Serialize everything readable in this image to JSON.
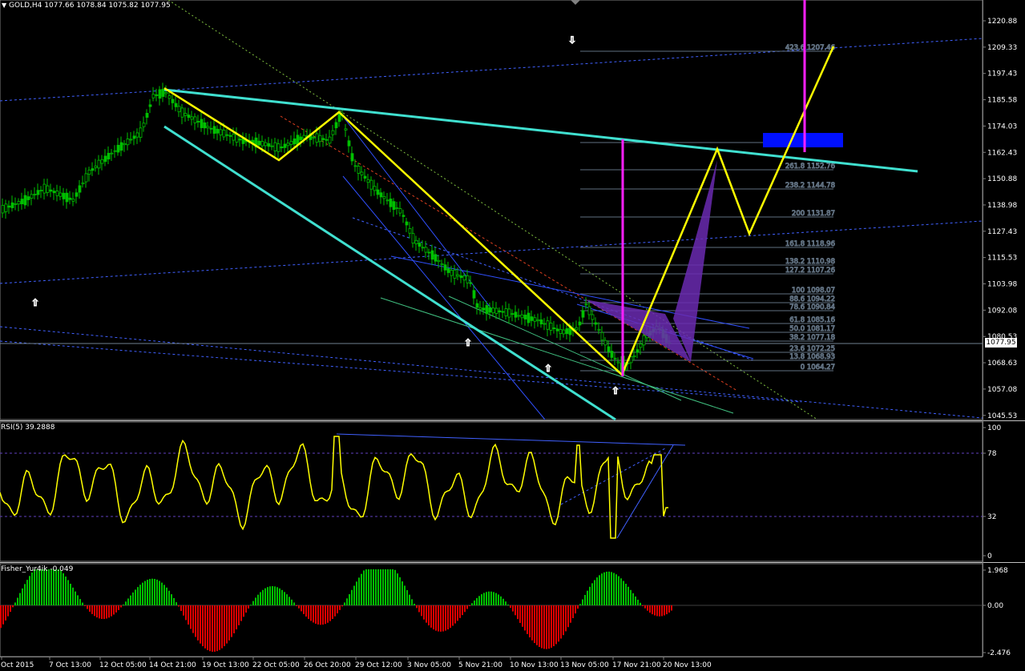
{
  "header": {
    "title": "GOLD,H4",
    "ohlc": "1077.66 1078.84 1075.82 1077.95"
  },
  "current_price": "1077.95",
  "price_axis": [
    "1220.88",
    "1209.33",
    "1197.43",
    "1185.58",
    "1174.03",
    "1162.43",
    "1150.88",
    "1138.98",
    "1127.43",
    "1115.53",
    "1103.98",
    "1092.08",
    "1080.53",
    "1068.63",
    "1057.08",
    "1045.53"
  ],
  "fib_levels": [
    "423.6 1207.46",
    "300 1165.67",
    "261.8 1152.76",
    "238.2 1144.78",
    "200 1131.87",
    "161.8 1118.96",
    "138.2 1110.98",
    "127.2 1107.26",
    "100 1098.07",
    "88.6 1094.22",
    "78.6 1090.84",
    "61.8 1085.16",
    "50.0 1081.17",
    "38.2 1077.18",
    "23.6 1072.25",
    "13.8 1068.93",
    "0 1064.27"
  ],
  "rsi": {
    "label": "RSI(5) 39.2888",
    "axis": [
      "100",
      "78",
      "32",
      "0"
    ]
  },
  "fisher": {
    "label": "Fisher_Yur4ik -0.049",
    "axis": [
      "1.968",
      "0.00",
      "-2.476"
    ]
  },
  "time_axis": [
    "Oct 2015",
    "7 Oct 13:00",
    "12 Oct 05:00",
    "14 Oct 21:00",
    "19 Oct 13:00",
    "22 Oct 05:00",
    "26 Oct 20:00",
    "29 Oct 12:00",
    "3 Nov 05:00",
    "5 Nov 21:00",
    "10 Nov 13:00",
    "13 Nov 05:00",
    "17 Nov 21:00",
    "20 Nov 13:00"
  ],
  "colors": {
    "background": "#000000",
    "candle": "#00c000",
    "zigzag": "#ffff00",
    "trendline": "#40e0d0",
    "projection": "#ff00ff",
    "fisher_up": "#00c000",
    "fisher_down": "#e00000",
    "marker": "#0000ff"
  }
}
